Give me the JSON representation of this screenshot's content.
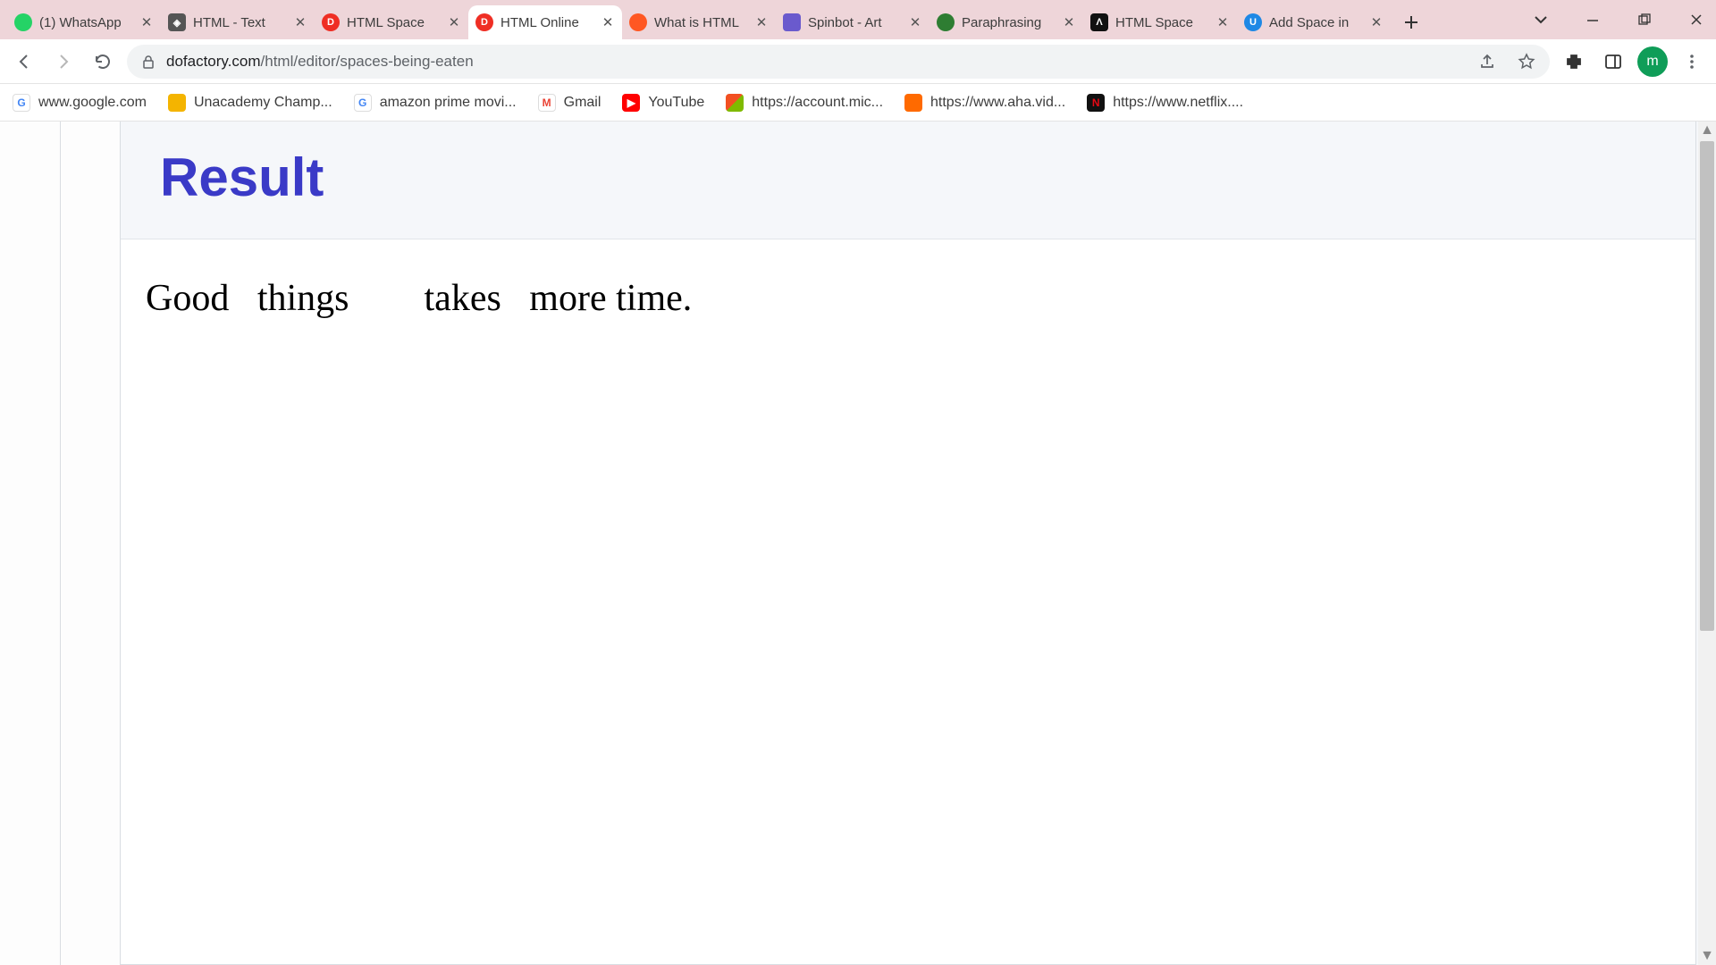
{
  "tabs": [
    {
      "title": "(1) WhatsApp",
      "favicon_bg": "#25d366",
      "favicon_txt": "",
      "active": false
    },
    {
      "title": "HTML - Text",
      "favicon_bg": "#444",
      "favicon_txt": "◈",
      "active": false
    },
    {
      "title": "HTML Space",
      "favicon_bg": "#ef2e24",
      "favicon_txt": "D",
      "active": false
    },
    {
      "title": "HTML Online",
      "favicon_bg": "#ef2e24",
      "favicon_txt": "D",
      "active": true
    },
    {
      "title": "What is HTML",
      "favicon_bg": "#ff5722",
      "favicon_txt": "",
      "active": false
    },
    {
      "title": "Spinbot - Art",
      "favicon_bg": "#6a5acd",
      "favicon_txt": "",
      "active": false
    },
    {
      "title": "Paraphrasing",
      "favicon_bg": "#2e7d32",
      "favicon_txt": "",
      "active": false
    },
    {
      "title": "HTML Space",
      "favicon_bg": "#111",
      "favicon_txt": "Λ",
      "active": false
    },
    {
      "title": "Add Space in",
      "favicon_bg": "#1e88e5",
      "favicon_txt": "U",
      "active": false
    }
  ],
  "address": {
    "domain": "dofactory.com",
    "path": "/html/editor/spaces-being-eaten"
  },
  "bookmarks": [
    {
      "label": "www.google.com",
      "bg": "#fff",
      "txt": "G"
    },
    {
      "label": "Unacademy Champ...",
      "bg": "#f4b400",
      "txt": ""
    },
    {
      "label": "amazon prime movi...",
      "bg": "#fff",
      "txt": "G"
    },
    {
      "label": "Gmail",
      "bg": "#ea4335",
      "txt": "M"
    },
    {
      "label": "YouTube",
      "bg": "#ff0000",
      "txt": "▶"
    },
    {
      "label": "https://account.mic...",
      "bg": "#00a4ef",
      "txt": "⊞"
    },
    {
      "label": "https://www.aha.vid...",
      "bg": "#ff6a00",
      "txt": ""
    },
    {
      "label": "https://www.netflix....",
      "bg": "#e50914",
      "txt": "N"
    }
  ],
  "avatar_letter": "m",
  "page": {
    "result_heading": "Result",
    "result_text": "Good   things        takes   more time."
  }
}
